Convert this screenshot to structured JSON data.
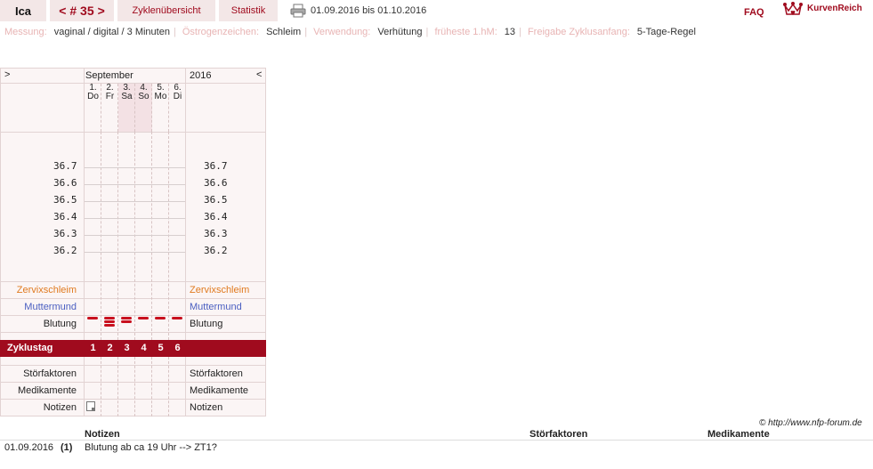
{
  "header": {
    "user": "Ica",
    "cycle_prev": "<",
    "cycle_label": "# 35",
    "cycle_next": ">",
    "tab_overview": "Zyklenübersicht",
    "tab_stats": "Statistik",
    "date_range": "01.09.2016 bis 01.10.2016",
    "faq": "FAQ",
    "brand": "KurvenReich"
  },
  "info": [
    {
      "label": "Messung:",
      "value": "vaginal / digital / 3 Minuten"
    },
    {
      "label": "Östrogenzeichen:",
      "value": "Schleim"
    },
    {
      "label": "Verwendung:",
      "value": "Verhütung"
    },
    {
      "label": "früheste 1.hM:",
      "value": "13"
    },
    {
      "label": "Freigabe Zyklusanfang:",
      "value": "5-Tage-Regel"
    }
  ],
  "chart": {
    "nav_left": ">",
    "nav_right": "<",
    "month": "September",
    "year": "2016",
    "days": [
      {
        "num": "1.",
        "dow": "Do"
      },
      {
        "num": "2.",
        "dow": "Fr"
      },
      {
        "num": "3.",
        "dow": "Sa"
      },
      {
        "num": "4.",
        "dow": "So"
      },
      {
        "num": "5.",
        "dow": "Mo"
      },
      {
        "num": "6.",
        "dow": "Di"
      }
    ],
    "temps": [
      "36.7",
      "36.6",
      "36.5",
      "36.4",
      "36.3",
      "36.2"
    ],
    "rows": {
      "cervix": "Zervixschleim",
      "mouth": "Muttermund",
      "bleeding": "Blutung",
      "cycle_day": "Zyklustag",
      "disturbances": "Störfaktoren",
      "medication": "Medikamente",
      "notes": "Notizen"
    },
    "cycle_days": [
      "1",
      "2",
      "3",
      "4",
      "5",
      "6"
    ],
    "bleeding_strength": [
      1,
      3,
      2,
      1,
      1,
      1
    ],
    "colors": {
      "accent": "#a00b1e",
      "cervix": "#e07a1f",
      "mouth": "#4a5fc1",
      "bleeding": "#c8101e"
    }
  },
  "copyright": "© http://www.nfp-forum.de",
  "notes_table": {
    "headers": {
      "notes": "Notizen",
      "disturbances": "Störfaktoren",
      "medication": "Medikamente"
    },
    "rows": [
      {
        "date": "01.09.2016",
        "day": "(1)",
        "note": "Blutung ab ca 19 Uhr --> ZT1?",
        "disturbances": "",
        "medication": ""
      }
    ]
  }
}
